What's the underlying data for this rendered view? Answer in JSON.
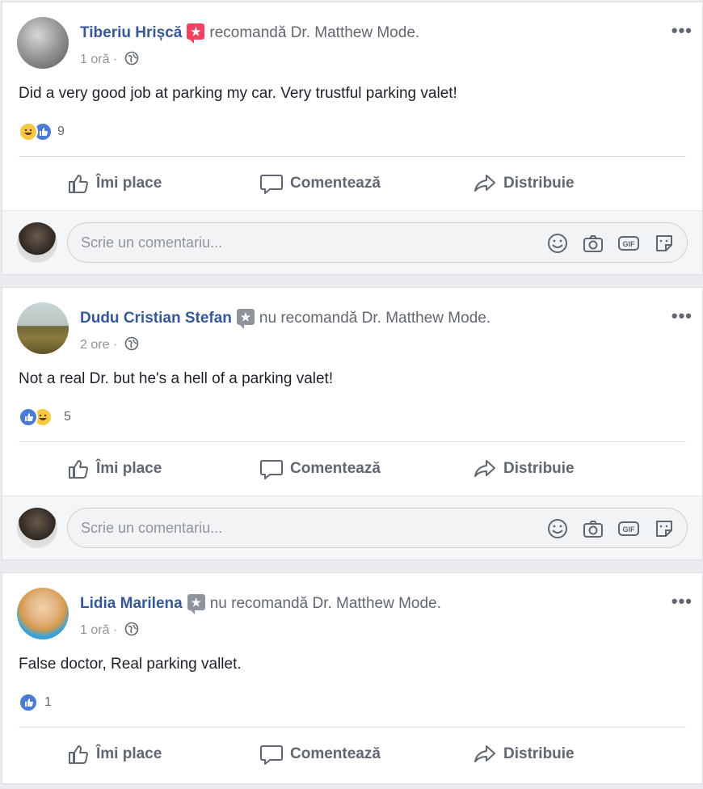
{
  "posts": [
    {
      "author": "Tiberiu Hrișcă",
      "action": "recomandă Dr. Matthew Mode.",
      "badge_color": "#f3425f",
      "time": "1 oră",
      "text": "Did a very good job at parking my car. Very trustful parking valet!",
      "reactions": [
        "haha",
        "like"
      ],
      "reaction_count": "9",
      "has_comment_box": true
    },
    {
      "author": "Dudu Cristian Stefan",
      "action": "nu recomandă Dr. Matthew Mode.",
      "badge_color": "#8d949e",
      "time": "2 ore",
      "text": "Not a real Dr. but he's a hell of a parking valet!",
      "reactions": [
        "like",
        "haha"
      ],
      "reaction_count": "5",
      "has_comment_box": true
    },
    {
      "author": "Lidia Marilena",
      "action": "nu recomandă Dr. Matthew Mode.",
      "badge_color": "#8d949e",
      "time": "1 oră",
      "text": "False doctor, Real parking vallet.",
      "reactions": [
        "like"
      ],
      "reaction_count": "1",
      "has_comment_box": false
    }
  ],
  "actions": {
    "like": "Îmi place",
    "comment": "Comentează",
    "share": "Distribuie"
  },
  "comment_placeholder": "Scrie un comentariu...",
  "icons": {
    "more": "more-options-icon",
    "globe": "globe-icon",
    "emoji": "emoji-icon",
    "camera": "camera-icon",
    "gif": "gif-icon",
    "sticker": "sticker-icon"
  },
  "colors": {
    "link": "#365899",
    "like_blue": "#4a7bd6",
    "haha_yellow": "#f7c843"
  }
}
